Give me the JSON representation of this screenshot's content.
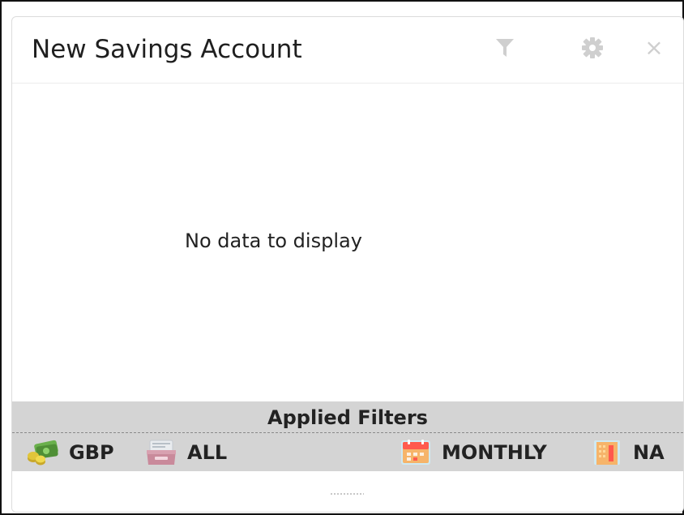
{
  "widget": {
    "title": "New Savings Account",
    "icons": {
      "filter": "filter-icon",
      "settings": "gear-icon",
      "close": "close-icon",
      "close_glyph": "×"
    },
    "empty_message": "No data to display"
  },
  "applied_filters": {
    "title": "Applied Filters",
    "items": [
      {
        "label": "GBP",
        "icon": "currency-money-icon"
      },
      {
        "label": "ALL",
        "icon": "branch-inbox-icon"
      },
      {
        "label": "MONTHLY",
        "icon": "calendar-icon"
      },
      {
        "label": "NA",
        "icon": "building-icon"
      }
    ]
  },
  "colors": {
    "header_icon": "#cfcfcf",
    "applied_bar": "#d4d4d4",
    "calendar_red": "#ff5a4e",
    "calendar_orange": "#f6b46a",
    "money_green": "#6ab04c",
    "coin_gold": "#e1c53a"
  }
}
